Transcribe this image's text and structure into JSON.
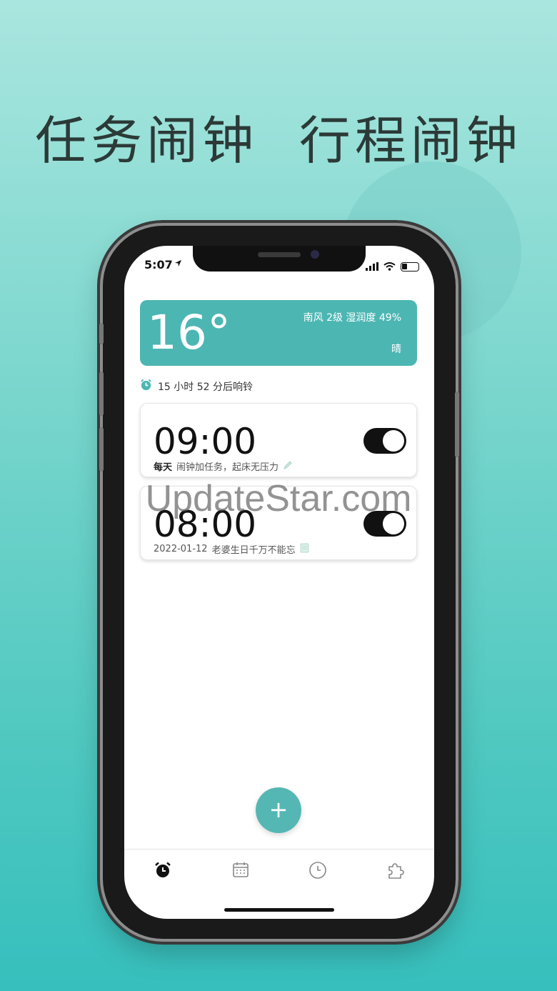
{
  "headline": "任务闹钟  行程闹钟",
  "status_bar": {
    "time": "5:07",
    "location_icon": "location-arrow-icon",
    "icons": [
      "signal-icon",
      "wifi-icon",
      "battery-icon"
    ]
  },
  "weather": {
    "temperature": "16°",
    "detail": "南风 2级 湿润度 49%",
    "condition": "晴",
    "background": "#4cb6b3"
  },
  "countdown": {
    "icon": "alarm-clock-icon",
    "text": "15 小时 52 分后响铃"
  },
  "alarms": [
    {
      "time": "09:00",
      "repeat": "每天",
      "label": "闹钟加任务，起床无压力",
      "enabled": true,
      "icon": "pencil-icon"
    },
    {
      "time": "08:00",
      "repeat": "2022-01-12",
      "label": "老婆生日千万不能忘",
      "enabled": true,
      "icon": "note-icon"
    }
  ],
  "fab": {
    "label": "+",
    "icon": "plus-icon"
  },
  "tabbar": [
    {
      "name": "alarm",
      "icon": "alarm-clock-icon",
      "active": true
    },
    {
      "name": "calendar",
      "icon": "calendar-icon",
      "active": false
    },
    {
      "name": "clock",
      "icon": "clock-icon",
      "active": false
    },
    {
      "name": "plugins",
      "icon": "puzzle-icon",
      "active": false
    }
  ],
  "watermark": "UpdateStar.com",
  "colors": {
    "accent": "#4cb6b3",
    "toggle_on": "#111111",
    "bg_top": "#a9e6df",
    "bg_bottom": "#36bfbd"
  }
}
